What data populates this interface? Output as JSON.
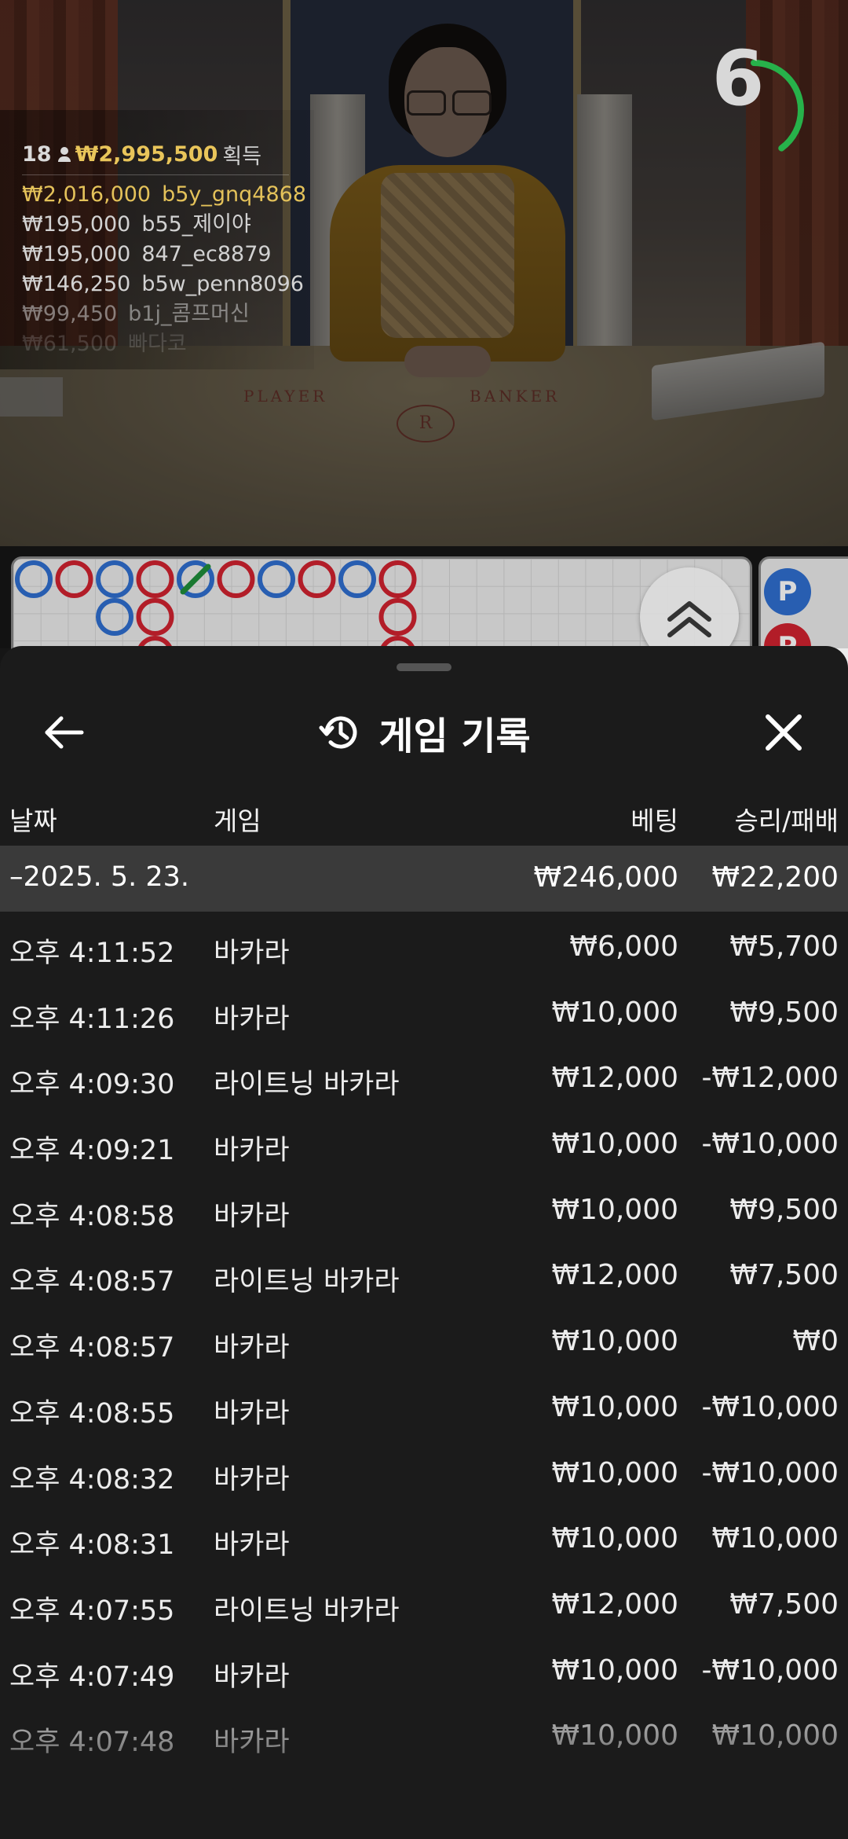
{
  "video": {
    "timer_value": "6",
    "timer_fraction": 0.4,
    "felt_player": "PLAYER",
    "felt_banker": "BANKER",
    "felt_logo": "R"
  },
  "winners": {
    "count": "18",
    "total": "₩2,995,500",
    "total_label": "획득",
    "list": [
      {
        "amount": "₩2,016,000",
        "name": "b5y_gnq4868"
      },
      {
        "amount": "₩195,000",
        "name": "b55_제이야"
      },
      {
        "amount": "₩195,000",
        "name": "847_ec8879"
      },
      {
        "amount": "₩146,250",
        "name": "b5w_penn8096"
      },
      {
        "amount": "₩99,450",
        "name": "b1j_콤프머신"
      },
      {
        "amount": "₩61,500",
        "name": "빠다코"
      }
    ]
  },
  "roadmap": {
    "badge_p": "P",
    "colors": {
      "player": "#2f6fd1",
      "banker": "#d2232f",
      "tie": "#1f8f3a"
    }
  },
  "sheet": {
    "title": "게임 기록",
    "title_icon": "history-icon",
    "back_icon": "arrow-left-icon",
    "close_icon": "close-icon",
    "columns": {
      "date": "날짜",
      "game": "게임",
      "bet": "베팅",
      "win_loss": "승리/패배"
    },
    "group": {
      "date": "–2025. 5. 23.",
      "bet": "₩246,000",
      "win_loss": "₩22,200"
    },
    "rows": [
      {
        "time": "오후 4:11:52",
        "game": "바카라",
        "bet": "₩6,000",
        "wl": "₩5,700"
      },
      {
        "time": "오후 4:11:26",
        "game": "바카라",
        "bet": "₩10,000",
        "wl": "₩9,500"
      },
      {
        "time": "오후 4:09:30",
        "game": "라이트닝 바카라",
        "bet": "₩12,000",
        "wl": "-₩12,000"
      },
      {
        "time": "오후 4:09:21",
        "game": "바카라",
        "bet": "₩10,000",
        "wl": "-₩10,000"
      },
      {
        "time": "오후 4:08:58",
        "game": "바카라",
        "bet": "₩10,000",
        "wl": "₩9,500"
      },
      {
        "time": "오후 4:08:57",
        "game": "라이트닝 바카라",
        "bet": "₩12,000",
        "wl": "₩7,500"
      },
      {
        "time": "오후 4:08:57",
        "game": "바카라",
        "bet": "₩10,000",
        "wl": "₩0"
      },
      {
        "time": "오후 4:08:55",
        "game": "바카라",
        "bet": "₩10,000",
        "wl": "-₩10,000"
      },
      {
        "time": "오후 4:08:32",
        "game": "바카라",
        "bet": "₩10,000",
        "wl": "-₩10,000"
      },
      {
        "time": "오후 4:08:31",
        "game": "바카라",
        "bet": "₩10,000",
        "wl": "₩10,000"
      },
      {
        "time": "오후 4:07:55",
        "game": "라이트닝 바카라",
        "bet": "₩12,000",
        "wl": "₩7,500"
      },
      {
        "time": "오후 4:07:49",
        "game": "바카라",
        "bet": "₩10,000",
        "wl": "-₩10,000"
      },
      {
        "time": "오후 4:07:48",
        "game": "바카라",
        "bet": "₩10,000",
        "wl": "₩10,000"
      }
    ]
  }
}
